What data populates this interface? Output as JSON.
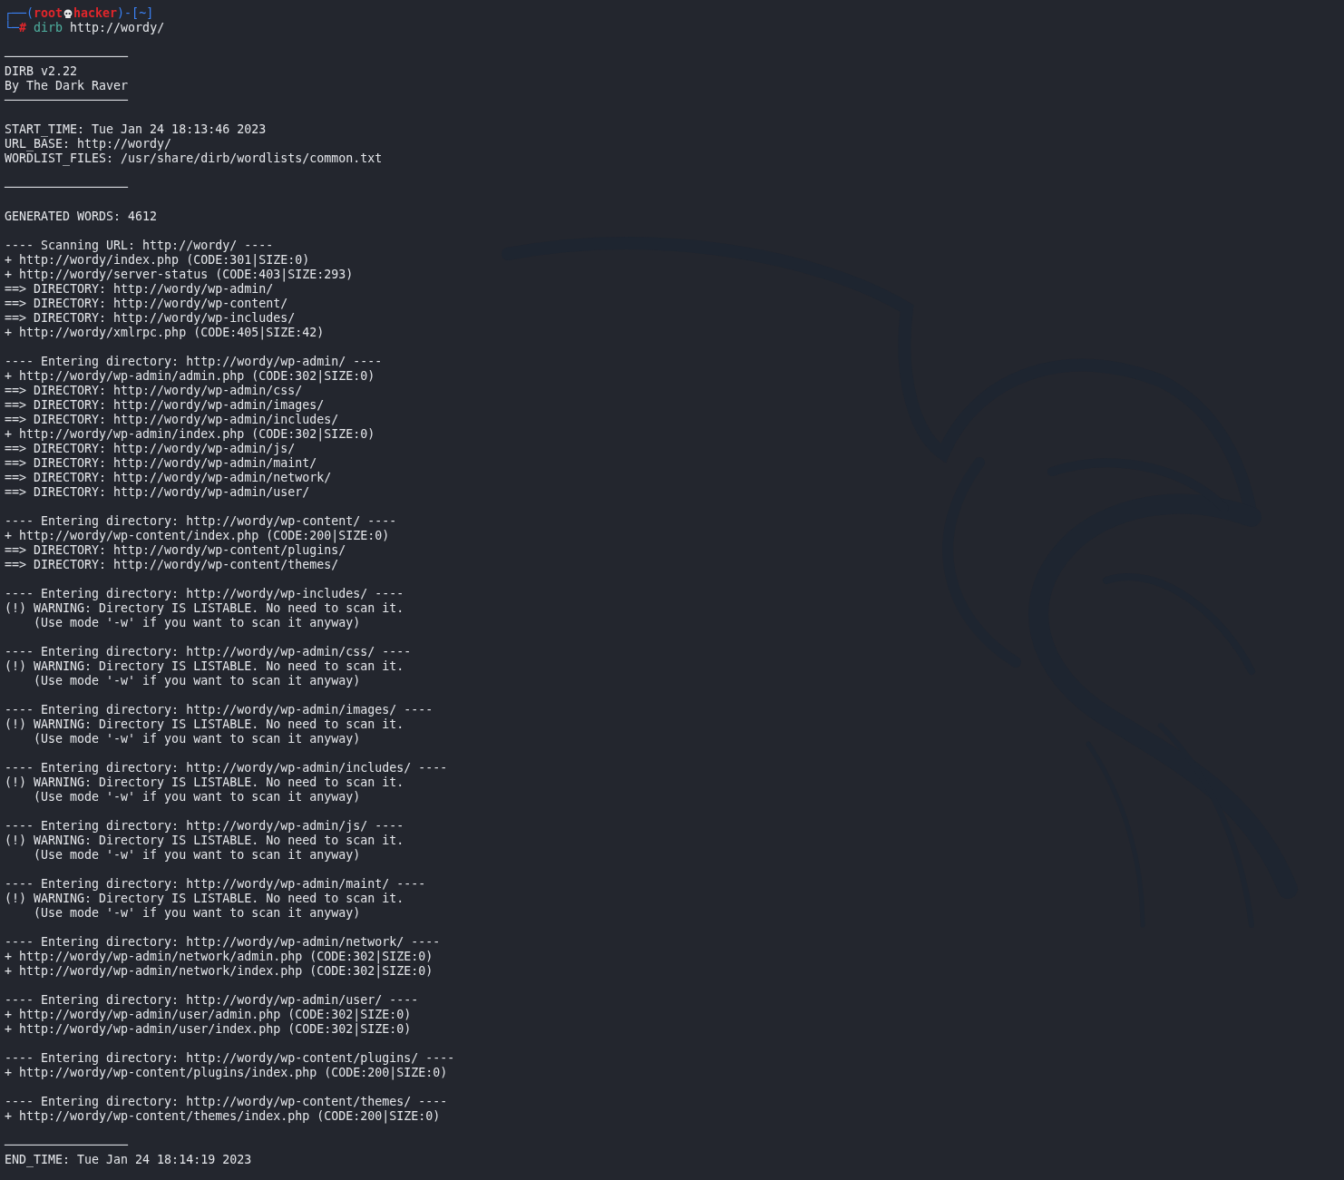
{
  "prompt": {
    "frame_top": "┌──(",
    "user": "root",
    "host": "hacker",
    "dir_part": ")-[~]",
    "frame_bottom": "└─",
    "symbol": "#",
    "command": "dirb",
    "args": "http://wordy/"
  },
  "lines": [
    {
      "kind": "blank"
    },
    {
      "kind": "rule",
      "text": "─────────────────"
    },
    {
      "kind": "text",
      "text": "DIRB v2.22"
    },
    {
      "kind": "text",
      "text": "By The Dark Raver"
    },
    {
      "kind": "rule",
      "text": "─────────────────"
    },
    {
      "kind": "blank"
    },
    {
      "kind": "text",
      "text": "START_TIME: Tue Jan 24 18:13:46 2023"
    },
    {
      "kind": "text",
      "text": "URL_BASE: http://wordy/"
    },
    {
      "kind": "text",
      "text": "WORDLIST_FILES: /usr/share/dirb/wordlists/common.txt"
    },
    {
      "kind": "blank"
    },
    {
      "kind": "rule",
      "text": "─────────────────"
    },
    {
      "kind": "blank"
    },
    {
      "kind": "text",
      "text": "GENERATED WORDS: 4612"
    },
    {
      "kind": "blank"
    },
    {
      "kind": "text",
      "text": "---- Scanning URL: http://wordy/ ----"
    },
    {
      "kind": "text",
      "text": "+ http://wordy/index.php (CODE:301|SIZE:0)"
    },
    {
      "kind": "text",
      "text": "+ http://wordy/server-status (CODE:403|SIZE:293)"
    },
    {
      "kind": "text",
      "text": "==> DIRECTORY: http://wordy/wp-admin/"
    },
    {
      "kind": "text",
      "text": "==> DIRECTORY: http://wordy/wp-content/"
    },
    {
      "kind": "text",
      "text": "==> DIRECTORY: http://wordy/wp-includes/"
    },
    {
      "kind": "text",
      "text": "+ http://wordy/xmlrpc.php (CODE:405|SIZE:42)"
    },
    {
      "kind": "blank"
    },
    {
      "kind": "text",
      "text": "---- Entering directory: http://wordy/wp-admin/ ----"
    },
    {
      "kind": "text",
      "text": "+ http://wordy/wp-admin/admin.php (CODE:302|SIZE:0)"
    },
    {
      "kind": "text",
      "text": "==> DIRECTORY: http://wordy/wp-admin/css/"
    },
    {
      "kind": "text",
      "text": "==> DIRECTORY: http://wordy/wp-admin/images/"
    },
    {
      "kind": "text",
      "text": "==> DIRECTORY: http://wordy/wp-admin/includes/"
    },
    {
      "kind": "text",
      "text": "+ http://wordy/wp-admin/index.php (CODE:302|SIZE:0)"
    },
    {
      "kind": "text",
      "text": "==> DIRECTORY: http://wordy/wp-admin/js/"
    },
    {
      "kind": "text",
      "text": "==> DIRECTORY: http://wordy/wp-admin/maint/"
    },
    {
      "kind": "text",
      "text": "==> DIRECTORY: http://wordy/wp-admin/network/"
    },
    {
      "kind": "text",
      "text": "==> DIRECTORY: http://wordy/wp-admin/user/"
    },
    {
      "kind": "blank"
    },
    {
      "kind": "text",
      "text": "---- Entering directory: http://wordy/wp-content/ ----"
    },
    {
      "kind": "text",
      "text": "+ http://wordy/wp-content/index.php (CODE:200|SIZE:0)"
    },
    {
      "kind": "text",
      "text": "==> DIRECTORY: http://wordy/wp-content/plugins/"
    },
    {
      "kind": "text",
      "text": "==> DIRECTORY: http://wordy/wp-content/themes/"
    },
    {
      "kind": "blank"
    },
    {
      "kind": "text",
      "text": "---- Entering directory: http://wordy/wp-includes/ ----"
    },
    {
      "kind": "text",
      "text": "(!) WARNING: Directory IS LISTABLE. No need to scan it."
    },
    {
      "kind": "text",
      "text": "    (Use mode '-w' if you want to scan it anyway)"
    },
    {
      "kind": "blank"
    },
    {
      "kind": "text",
      "text": "---- Entering directory: http://wordy/wp-admin/css/ ----"
    },
    {
      "kind": "text",
      "text": "(!) WARNING: Directory IS LISTABLE. No need to scan it."
    },
    {
      "kind": "text",
      "text": "    (Use mode '-w' if you want to scan it anyway)"
    },
    {
      "kind": "blank"
    },
    {
      "kind": "text",
      "text": "---- Entering directory: http://wordy/wp-admin/images/ ----"
    },
    {
      "kind": "text",
      "text": "(!) WARNING: Directory IS LISTABLE. No need to scan it."
    },
    {
      "kind": "text",
      "text": "    (Use mode '-w' if you want to scan it anyway)"
    },
    {
      "kind": "blank"
    },
    {
      "kind": "text",
      "text": "---- Entering directory: http://wordy/wp-admin/includes/ ----"
    },
    {
      "kind": "text",
      "text": "(!) WARNING: Directory IS LISTABLE. No need to scan it."
    },
    {
      "kind": "text",
      "text": "    (Use mode '-w' if you want to scan it anyway)"
    },
    {
      "kind": "blank"
    },
    {
      "kind": "text",
      "text": "---- Entering directory: http://wordy/wp-admin/js/ ----"
    },
    {
      "kind": "text",
      "text": "(!) WARNING: Directory IS LISTABLE. No need to scan it."
    },
    {
      "kind": "text",
      "text": "    (Use mode '-w' if you want to scan it anyway)"
    },
    {
      "kind": "blank"
    },
    {
      "kind": "text",
      "text": "---- Entering directory: http://wordy/wp-admin/maint/ ----"
    },
    {
      "kind": "text",
      "text": "(!) WARNING: Directory IS LISTABLE. No need to scan it."
    },
    {
      "kind": "text",
      "text": "    (Use mode '-w' if you want to scan it anyway)"
    },
    {
      "kind": "blank"
    },
    {
      "kind": "text",
      "text": "---- Entering directory: http://wordy/wp-admin/network/ ----"
    },
    {
      "kind": "text",
      "text": "+ http://wordy/wp-admin/network/admin.php (CODE:302|SIZE:0)"
    },
    {
      "kind": "text",
      "text": "+ http://wordy/wp-admin/network/index.php (CODE:302|SIZE:0)"
    },
    {
      "kind": "blank"
    },
    {
      "kind": "text",
      "text": "---- Entering directory: http://wordy/wp-admin/user/ ----"
    },
    {
      "kind": "text",
      "text": "+ http://wordy/wp-admin/user/admin.php (CODE:302|SIZE:0)"
    },
    {
      "kind": "text",
      "text": "+ http://wordy/wp-admin/user/index.php (CODE:302|SIZE:0)"
    },
    {
      "kind": "blank"
    },
    {
      "kind": "text",
      "text": "---- Entering directory: http://wordy/wp-content/plugins/ ----"
    },
    {
      "kind": "text",
      "text": "+ http://wordy/wp-content/plugins/index.php (CODE:200|SIZE:0)"
    },
    {
      "kind": "blank"
    },
    {
      "kind": "text",
      "text": "---- Entering directory: http://wordy/wp-content/themes/ ----"
    },
    {
      "kind": "text",
      "text": "+ http://wordy/wp-content/themes/index.php (CODE:200|SIZE:0)"
    },
    {
      "kind": "blank"
    },
    {
      "kind": "rule",
      "text": "─────────────────"
    },
    {
      "kind": "text",
      "text": "END_TIME: Tue Jan 24 18:14:19 2023"
    }
  ]
}
